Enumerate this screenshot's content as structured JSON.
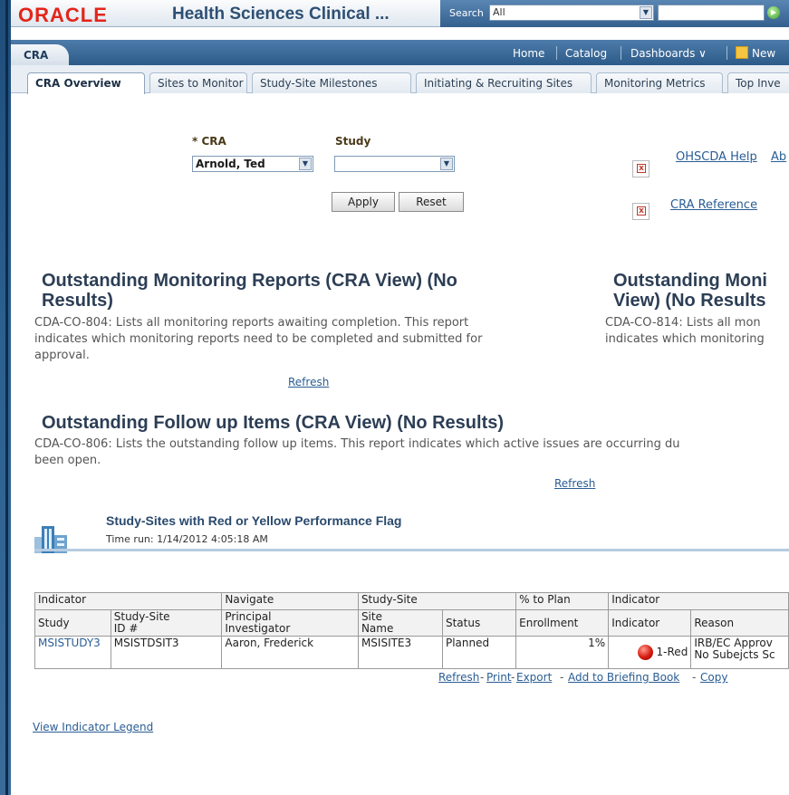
{
  "header": {
    "logo": "ORACLE",
    "app_title": "Health Sciences Clinical ...",
    "search_label": "Search",
    "search_scope": "All"
  },
  "dashboard": {
    "name": "CRA",
    "nav": {
      "home": "Home",
      "catalog": "Catalog",
      "dashboards": "Dashboards ∨",
      "new": "New"
    }
  },
  "tabs": [
    "CRA Overview",
    "Sites to Monitor",
    "Study-Site Milestones",
    "Initiating & Recruiting Sites",
    "Monitoring Metrics",
    "Top Inve"
  ],
  "prompts": {
    "cra_label": "* CRA",
    "cra_value": "Arnold, Ted",
    "study_label": "Study",
    "study_value": "",
    "apply": "Apply",
    "reset": "Reset"
  },
  "help_links": {
    "help": "OHSCDA Help",
    "about": "Ab",
    "reference": "CRA Reference"
  },
  "reports": {
    "r1": {
      "title_l1": "Outstanding Monitoring Reports (CRA View) (No",
      "title_l2": "Results)",
      "desc_l1": "CDA-CO-804: Lists all monitoring reports awaiting completion. This report",
      "desc_l2": "indicates which monitoring reports need to be completed and submitted for",
      "desc_l3": "approval.",
      "refresh": "Refresh"
    },
    "r2": {
      "title_l1": "Outstanding Moni",
      "title_l2": "View) (No Results",
      "desc_l1": "CDA-CO-814: Lists all mon",
      "desc_l2": "indicates which monitoring"
    },
    "r3": {
      "title": "Outstanding Follow up Items (CRA View) (No Results)",
      "desc_l1": "CDA-CO-806: Lists the outstanding follow up items. This report indicates which active issues are occurring du",
      "desc_l2": "been open.",
      "refresh": "Refresh"
    }
  },
  "study_sites": {
    "title": "Study-Sites with Red or Yellow Performance Flag",
    "time_run": "Time run: 1/14/2012 4:05:18 AM",
    "group_headers": [
      "Indicator",
      "Navigate",
      "Study-Site",
      "% to Plan",
      "Indicator"
    ],
    "col_headers": {
      "study": "Study",
      "site_id_1": "Study-Site",
      "site_id_2": "ID #",
      "pi_1": "Principal",
      "pi_2": "Investigator",
      "site_name_1": "Site",
      "site_name_2": "Name",
      "status": "Status",
      "enrollment": "Enrollment",
      "indicator": "Indicator",
      "reason": "Reason"
    },
    "row": {
      "study": "MSISTUDY3",
      "site_id": "MSISTDSIT3",
      "pi": "Aaron, Frederick",
      "site_name": "MSISITE3",
      "status": "Planned",
      "enrollment": "1%",
      "indicator": "1-Red",
      "reason_1": "IRB/EC Approv",
      "reason_2": "No Subejcts Sc"
    },
    "footer": {
      "refresh": "Refresh",
      "print": "Print",
      "export": "Export",
      "briefing": "Add to Briefing Book",
      "copy": "Copy",
      "sep": "-"
    }
  },
  "legend_link": "View Indicator Legend"
}
